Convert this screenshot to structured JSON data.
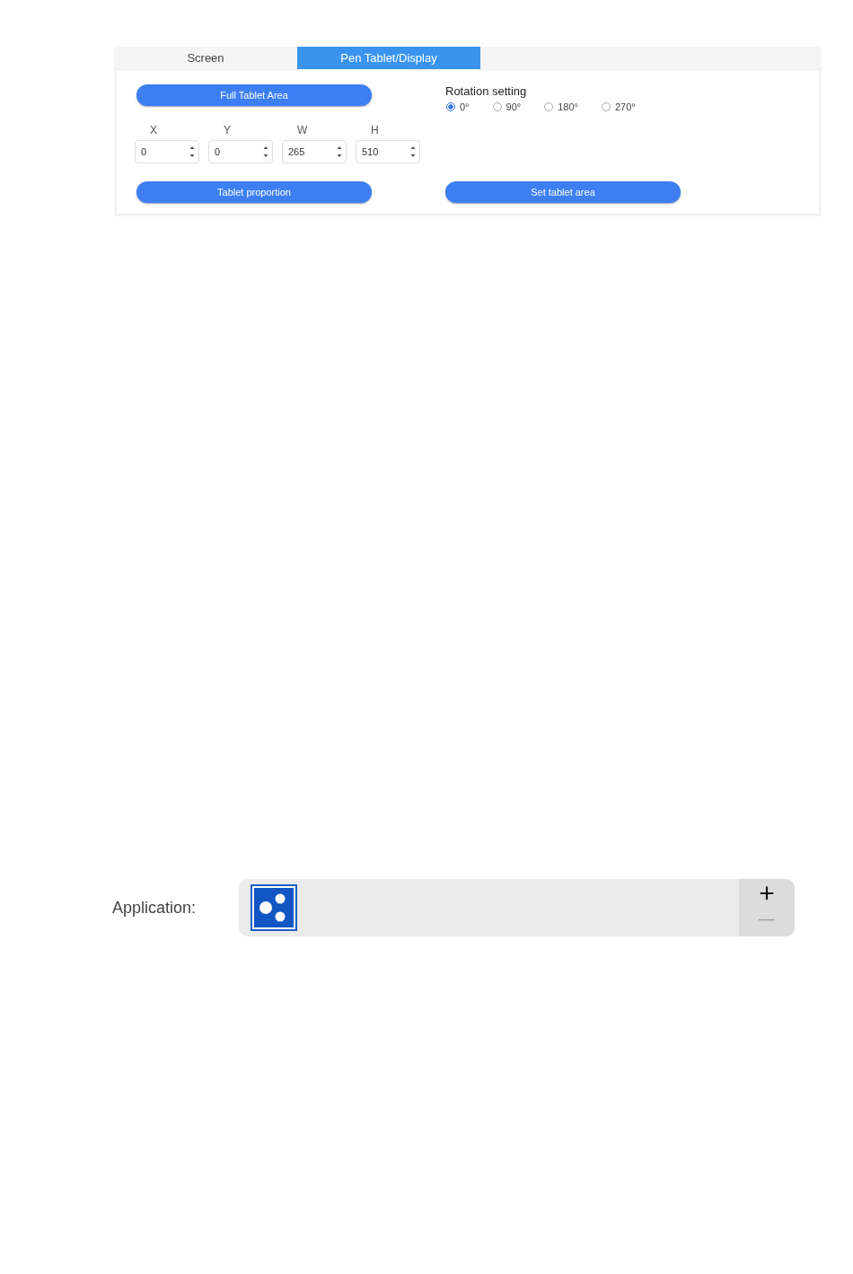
{
  "tabs": [
    {
      "label": "Screen",
      "selected": false
    },
    {
      "label": "Pen Tablet/Display",
      "selected": true
    }
  ],
  "full_area_button": "Full Tablet Area",
  "fields": [
    {
      "label": "X",
      "value": "0"
    },
    {
      "label": "Y",
      "value": "0"
    },
    {
      "label": "W",
      "value": "265"
    },
    {
      "label": "H",
      "value": "510"
    }
  ],
  "rotation": {
    "title": "Rotation setting",
    "options": [
      {
        "label": "0°",
        "selected": true
      },
      {
        "label": "90°",
        "selected": false
      },
      {
        "label": "180°",
        "selected": false
      },
      {
        "label": "270°",
        "selected": false
      }
    ]
  },
  "buttons": [
    "Tablet proportion",
    "Set tablet area"
  ],
  "application": {
    "label": "Application:",
    "add": "+",
    "remove": "—"
  }
}
